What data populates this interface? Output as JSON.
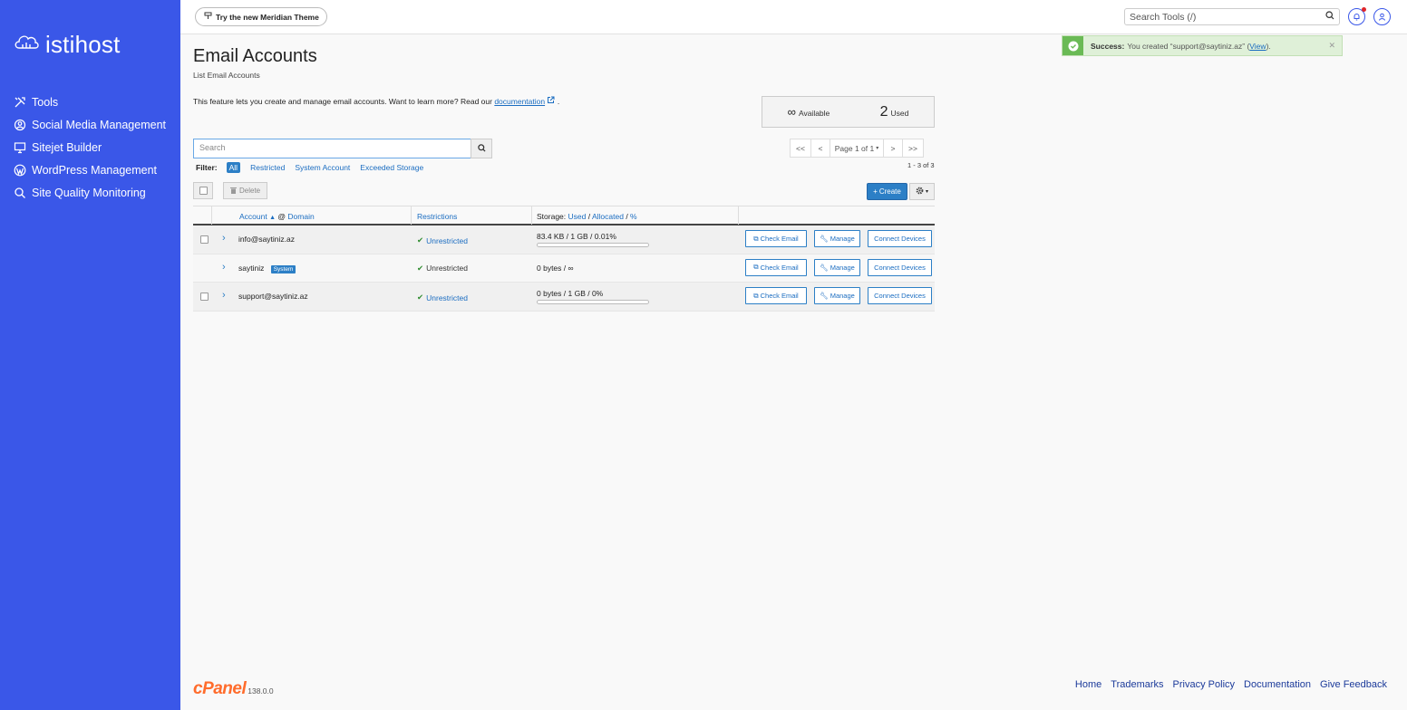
{
  "brand": {
    "name": "istihost"
  },
  "sidebar": {
    "items": [
      {
        "label": "Tools",
        "icon": "tools-icon"
      },
      {
        "label": "Social Media Management",
        "icon": "social-icon"
      },
      {
        "label": "Sitejet Builder",
        "icon": "monitor-icon"
      },
      {
        "label": "WordPress Management",
        "icon": "wordpress-icon"
      },
      {
        "label": "Site Quality Monitoring",
        "icon": "search-icon"
      }
    ]
  },
  "header": {
    "theme_button": "Try the new Meridian Theme",
    "search_placeholder": "Search Tools (/)"
  },
  "page": {
    "title": "Email Accounts",
    "subtitle": "List Email Accounts",
    "intro_text": "This feature lets you create and manage email accounts. Want to learn more? Read our",
    "intro_link": "documentation",
    "intro_end": "."
  },
  "stats": {
    "available_value": "∞",
    "available_label": "Available",
    "used_value": "2",
    "used_label": "Used"
  },
  "search": {
    "placeholder": "Search"
  },
  "filter": {
    "label": "Filter:",
    "options": [
      "All",
      "Restricted",
      "System Account",
      "Exceeded Storage"
    ],
    "active": "All"
  },
  "pager": {
    "first": "<<",
    "prev": "<",
    "page": "Page 1 of 1",
    "next": ">",
    "last": ">>",
    "count": "1 - 3 of 3"
  },
  "toolbar": {
    "delete_label": "Delete",
    "create_label": "Create"
  },
  "table": {
    "headers": {
      "account": "Account",
      "at": "@",
      "domain": "Domain",
      "restrictions": "Restrictions",
      "storage_prefix": "Storage:",
      "used": "Used",
      "allocated": "Allocated",
      "percent": "%"
    },
    "rows": [
      {
        "account": "info@saytiniz.az",
        "badge": "",
        "restriction": "Unrestricted",
        "storage": "83.4 KB / 1 GB / 0.01%",
        "usage_percent": 0.01,
        "show_bar": true
      },
      {
        "account": "saytiniz",
        "badge": "System",
        "restriction": "Unrestricted",
        "storage": "0 bytes / ∞",
        "usage_percent": 0,
        "show_bar": false
      },
      {
        "account": "support@saytiniz.az",
        "badge": "",
        "restriction": "Unrestricted",
        "storage": "0 bytes / 1 GB / 0%",
        "usage_percent": 0,
        "show_bar": true
      }
    ],
    "actions": {
      "check_email": "Check Email",
      "manage": "Manage",
      "connect_devices": "Connect Devices"
    }
  },
  "toast": {
    "title": "Success:",
    "message": "You created “support@saytiniz.az” (",
    "link": "View",
    "end": ")."
  },
  "footer": {
    "logo": "cPanel",
    "version": "138.0.0",
    "links": [
      "Home",
      "Trademarks",
      "Privacy Policy",
      "Documentation",
      "Give Feedback"
    ]
  },
  "colors": {
    "sidebar": "#3a57e8",
    "primary": "#2c7fc6",
    "link": "#1b6dc1",
    "success": "#6aba55",
    "cpanel_orange": "#ff6c2c"
  }
}
